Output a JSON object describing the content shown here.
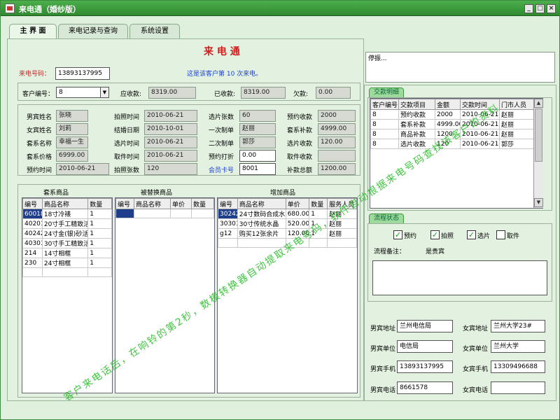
{
  "window": {
    "title": "来电通（婚纱版）",
    "min": "_",
    "max": "□",
    "close": "×"
  },
  "tabs": [
    "主 界 面",
    "来电记录与查询",
    "系统设置"
  ],
  "main": {
    "heading": "来 电 通",
    "caller_label": "来电号码：",
    "caller_value": "13893137995",
    "call_note": "这是该客户第 10 次来电。"
  },
  "memo": {
    "value": "停振..."
  },
  "customer": {
    "id_label": "客户编号：",
    "id_value": "8",
    "due_label": "应收款:",
    "due_value": "8319.00",
    "paid_label": "已收款:",
    "paid_value": "8319.00",
    "owe_label": "欠款:",
    "owe_value": "0.00"
  },
  "details": {
    "col1": [
      {
        "label": "男宾姓名",
        "value": "张晓"
      },
      {
        "label": "女宾姓名",
        "value": "刘莉"
      },
      {
        "label": "套系名称",
        "value": "幸福一生"
      },
      {
        "label": "套系价格",
        "value": "6999.00"
      },
      {
        "label": "预约时间",
        "value": "2010-06-21"
      }
    ],
    "col2": [
      {
        "label": "拍照时间",
        "value": "2010-06-21"
      },
      {
        "label": "结婚日期",
        "value": "2010-10-01"
      },
      {
        "label": "选片时间",
        "value": "2010-06-21"
      },
      {
        "label": "取件时间",
        "value": "2010-06-21"
      },
      {
        "label": "拍照张数",
        "value": "120"
      }
    ],
    "col3": [
      {
        "label": "选片张数",
        "value": "60"
      },
      {
        "label": "一次制单",
        "value": "赵丽"
      },
      {
        "label": "二次制单",
        "value": "郭莎"
      },
      {
        "label": "预约打折",
        "value": "0.00"
      },
      {
        "label": "会员卡号",
        "value": "8001"
      }
    ],
    "col4": [
      {
        "label": "预约收款",
        "value": "2000"
      },
      {
        "label": "套系补款",
        "value": "4999.00"
      },
      {
        "label": "选片收款",
        "value": "120.00"
      },
      {
        "label": "取件收款",
        "value": ""
      },
      {
        "label": "补款总额",
        "value": "1200.00"
      }
    ]
  },
  "package_goods": {
    "title": "套系商品",
    "headers": [
      "编号",
      "商品名称",
      "数量"
    ],
    "rows": [
      [
        "60018",
        "18寸冷裱",
        "1"
      ],
      [
        "40201",
        "20寸手工精致活",
        "1"
      ],
      [
        "40242",
        "24寸金(银)砂活",
        "1"
      ],
      [
        "40301",
        "30寸手工精致活",
        "1"
      ],
      [
        "214",
        "14寸相框",
        "1"
      ],
      [
        "230",
        "24寸相框",
        "1"
      ]
    ]
  },
  "replaced_goods": {
    "title": "被替换商品",
    "headers": [
      "编号",
      "商品名称",
      "单价",
      "数量"
    ]
  },
  "added_goods": {
    "title": "增加商品",
    "headers": [
      "编号",
      "商品名称",
      "单价",
      "数量",
      "服务人员"
    ],
    "rows": [
      [
        "30242",
        "24寸数码合成水",
        "680.00",
        "1",
        "赵丽"
      ],
      [
        "30301",
        "30寸传统水晶",
        "520.00",
        "1",
        "赵丽"
      ],
      [
        "g12",
        "购买12张余片",
        "120.00",
        "1",
        "赵丽"
      ]
    ]
  },
  "transactions": {
    "tab": "交款明细",
    "headers": [
      "客户编号",
      "交款项目",
      "金额",
      "交款时间",
      "门市人员"
    ],
    "rows": [
      [
        "8",
        "预约收款",
        "2000",
        "2010-06-21",
        "赵丽"
      ],
      [
        "8",
        "套系补款",
        "4999.00",
        "2010-06-21",
        "赵丽"
      ],
      [
        "8",
        "商品补款",
        "1200",
        "2010-06-21",
        "赵丽"
      ],
      [
        "8",
        "选片收款",
        "120",
        "2010-06-21",
        "郭莎"
      ]
    ]
  },
  "process": {
    "tab": "流程状态",
    "checks": [
      {
        "label": "预约",
        "checked": true
      },
      {
        "label": "拍照",
        "checked": true
      },
      {
        "label": "选片",
        "checked": true
      },
      {
        "label": "取件",
        "checked": false
      }
    ],
    "note_label": "流程备注：",
    "note_value": "是贵宾"
  },
  "contacts": [
    {
      "label": "男宾地址",
      "value": "兰州电信局",
      "label2": "女宾地址",
      "value2": "兰州大学23#"
    },
    {
      "label": "男宾单位",
      "value": "电信局",
      "label2": "女宾单位",
      "value2": "兰州大学"
    },
    {
      "label": "男宾手机",
      "value": "13893137995",
      "label2": "女宾手机",
      "value2": "13309496688"
    },
    {
      "label": "男宾电话",
      "value": "8661578",
      "label2": "女宾电话",
      "value2": ""
    }
  ],
  "watermark": "客户来电话后，在响铃的第2秒，数模转换器自动提取来电号码，软件自动根据来电号码查找该客户的资料"
}
